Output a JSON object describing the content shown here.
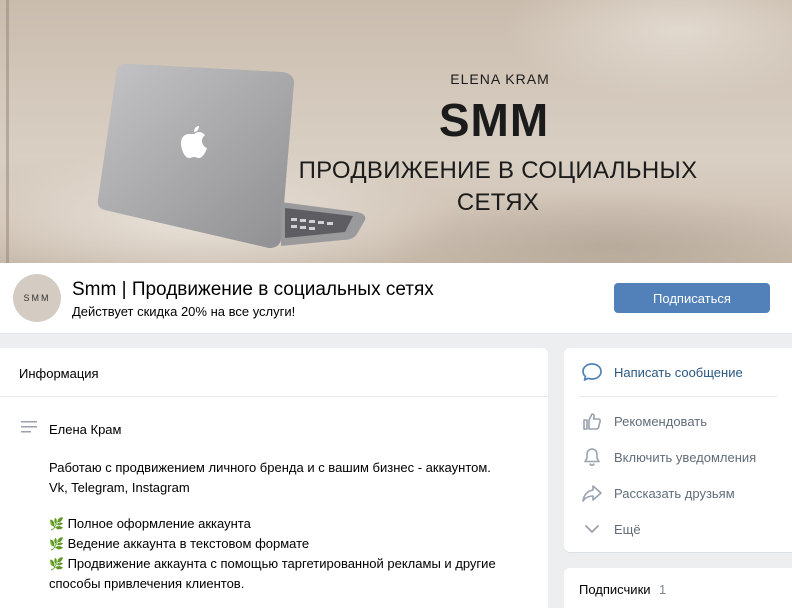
{
  "cover": {
    "subtitle": "ELENA KRAM",
    "title": "SMM",
    "tagline_line1": "ПРОДВИЖЕНИЕ В СОЦИАЛЬНЫХ",
    "tagline_line2": "СЕТЯХ"
  },
  "header": {
    "avatar_text": "SMM",
    "group_name": "Smm | Продвижение в социальных сетях",
    "status": "Действует скидка 20% на все услуги!",
    "subscribe_label": "Подписаться"
  },
  "info": {
    "title": "Информация",
    "author": "Елена Крам",
    "paragraph_line1": "Работаю с продвижением личного бренда и с вашим бизнес - аккаунтом.",
    "paragraph_line2": "Vk, Telegram, Instagram",
    "bullets": [
      "Полное оформление аккаунта",
      "Ведение аккаунта в текстовом формате",
      "Продвижение аккаунта с помощью таргетированной рекламы и другие способы привлечения клиентов."
    ]
  },
  "actions": {
    "message": "Написать сообщение",
    "recommend": "Рекомендовать",
    "notifications": "Включить уведомления",
    "share": "Рассказать друзьям",
    "more": "Ещё"
  },
  "subscribers": {
    "title": "Подписчики",
    "count": "1"
  },
  "colors": {
    "accent": "#5181b8",
    "link": "#2a5885",
    "secondary_text": "#626d7a",
    "page_bg": "#edeef0"
  },
  "icons": [
    "message-icon",
    "like-icon",
    "bell-icon",
    "share-icon",
    "chevron-down-icon",
    "lines-icon",
    "apple-logo-icon",
    "leaf-icon"
  ]
}
